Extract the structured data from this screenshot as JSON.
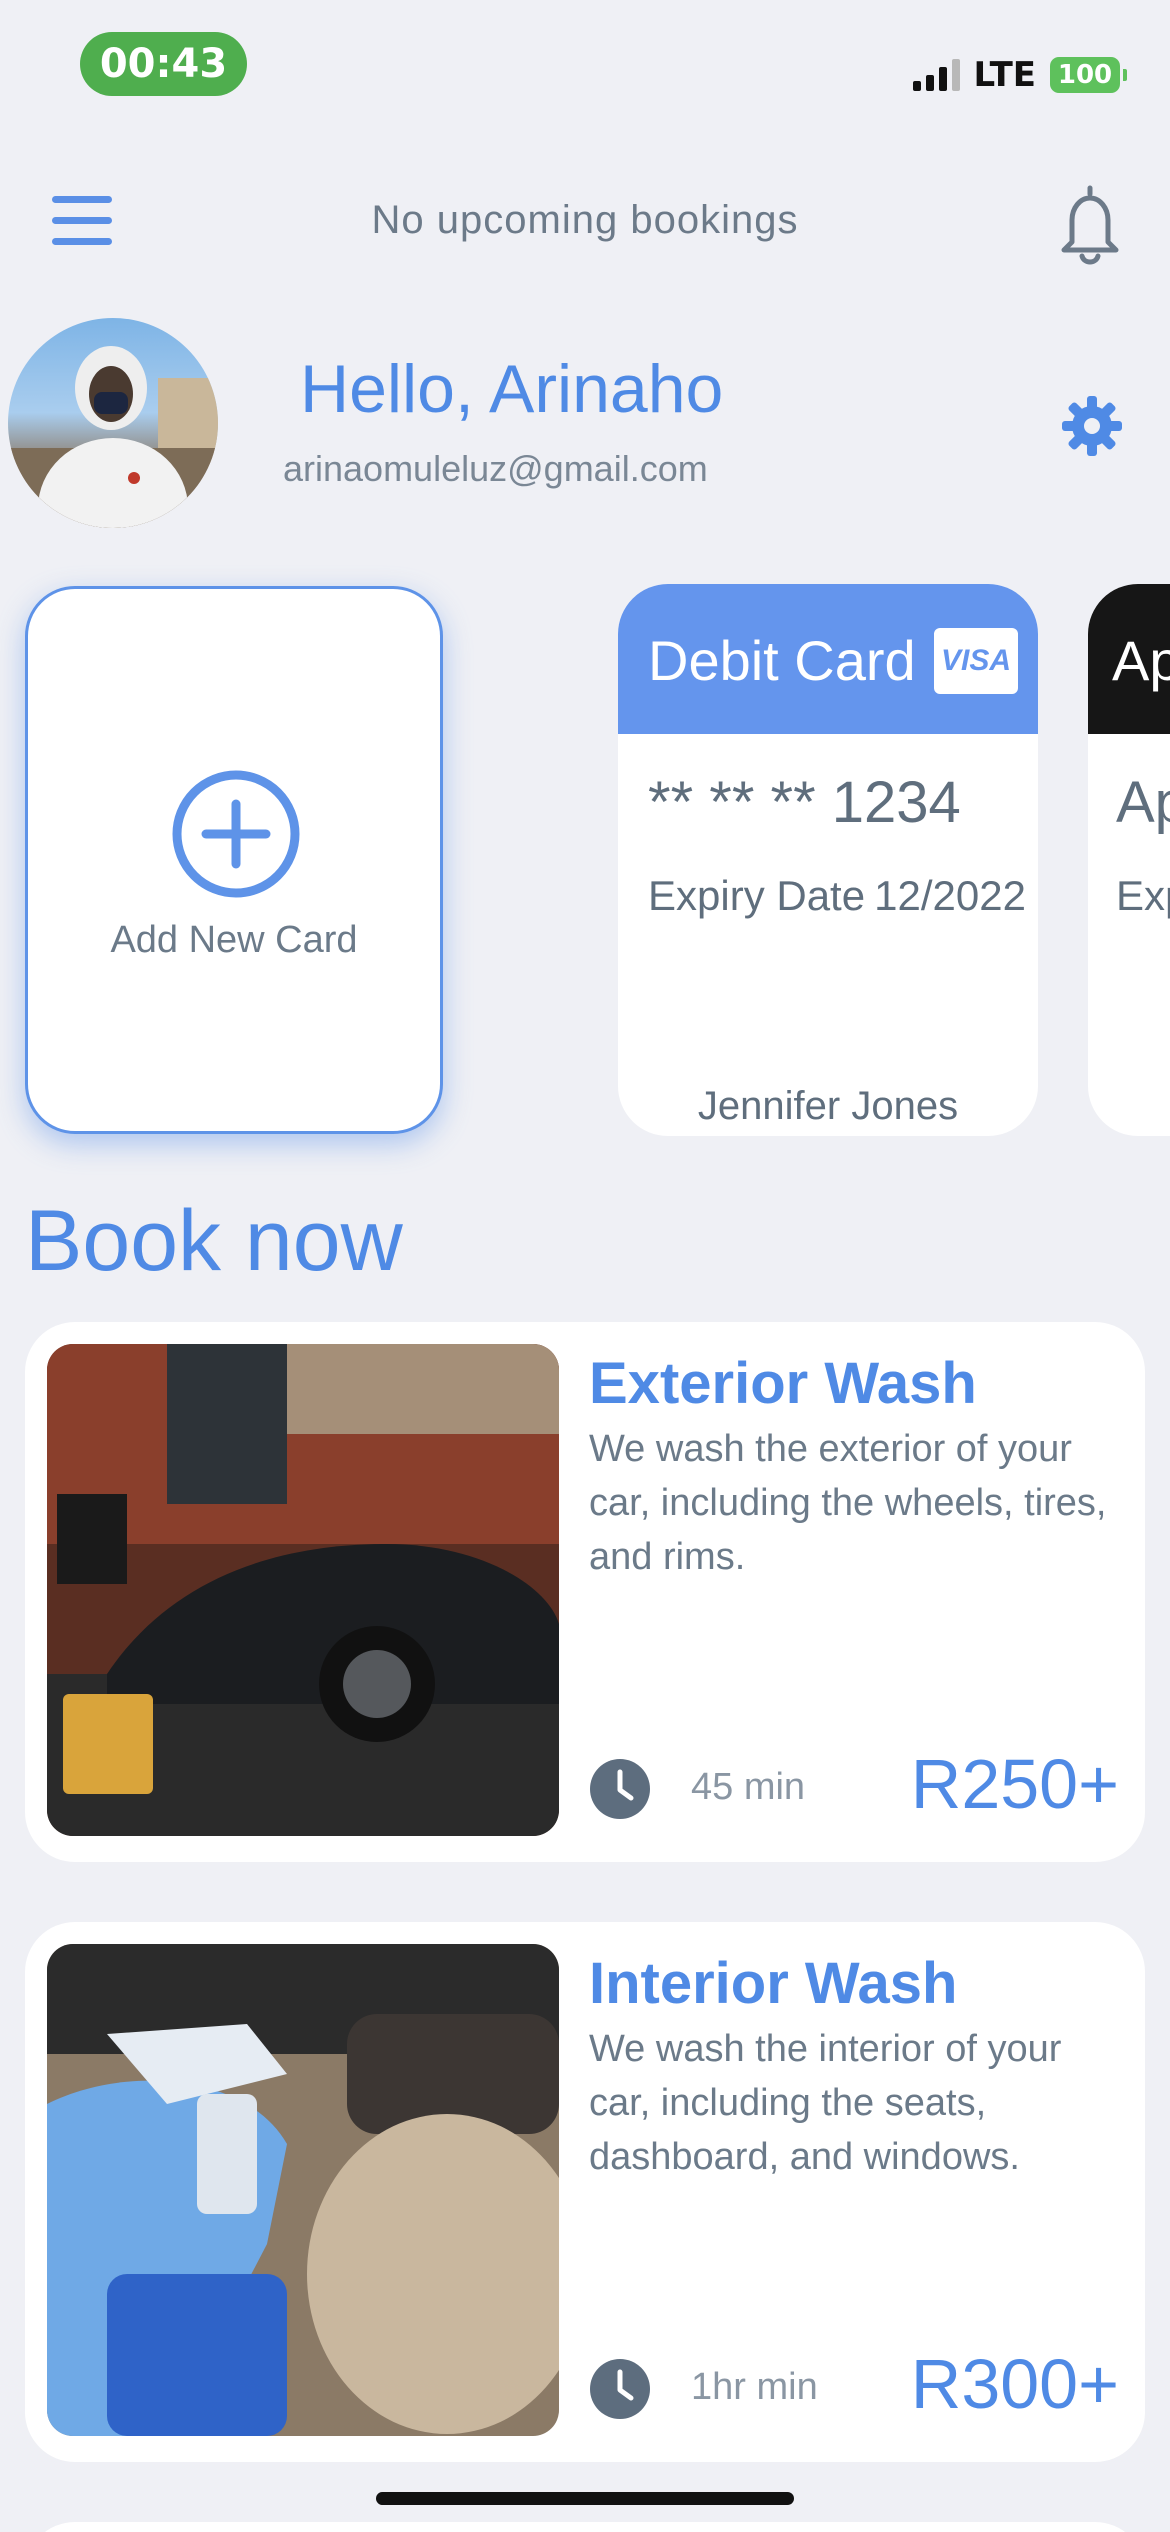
{
  "status_bar": {
    "time": "00:43",
    "network": "LTE",
    "battery": "100"
  },
  "header": {
    "title": "No upcoming bookings"
  },
  "profile": {
    "greeting": "Hello, Arinaho",
    "email": "arinaomuleluz@gmail.com"
  },
  "cards": {
    "add_label": "Add New Card",
    "debit": {
      "title": "Debit Card",
      "brand": "VISA",
      "number": "** ** ** 1234",
      "expiry_label": "Expiry Date",
      "expiry_value": "12/2022",
      "holder": "Jennifer Jones"
    },
    "partial": {
      "title": "Ap",
      "line1": "Ap",
      "line2": "Exp"
    }
  },
  "book": {
    "title": "Book now",
    "services": [
      {
        "name": "Exterior Wash",
        "description": "We wash the exterior of your car, including the wheels, tires, and rims.",
        "duration": "45 min",
        "price": "R250+"
      },
      {
        "name": "Interior Wash",
        "description": "We wash the interior of your car, including the seats, dashboard, and windows.",
        "duration": "1hr min",
        "price": "R300+"
      }
    ]
  },
  "colors": {
    "accent": "#4f8ae5",
    "card_header": "#6495ed",
    "background": "#eff0f5",
    "status_green": "#4fae4e"
  },
  "icons": [
    "menu-icon",
    "bell-icon",
    "gear-icon",
    "plus-circle-icon",
    "visa-logo",
    "clock-icon"
  ]
}
